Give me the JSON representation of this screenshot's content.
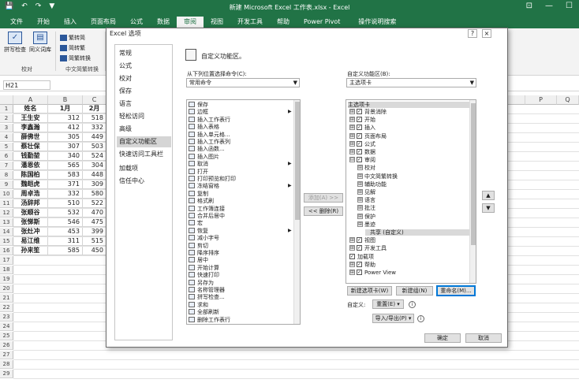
{
  "titlebar": {
    "title": "新建 Microsoft Excel 工作表.xlsx - Excel",
    "qat": [
      "💾",
      "↶",
      "↷",
      "▼"
    ],
    "winbtns": [
      "⊡",
      "—",
      "☐"
    ]
  },
  "tabs": [
    "文件",
    "开始",
    "插入",
    "页面布局",
    "公式",
    "数据",
    "审阅",
    "视图",
    "开发工具",
    "帮助",
    "Power Pivot",
    "操作说明搜索"
  ],
  "active_tab": "审阅",
  "ribbon": {
    "spell_check": "拼写检查",
    "thesaurus": "同义词库",
    "proofing_group": "校对",
    "to_traditional": "繁转简",
    "to_simplified": "简转繁",
    "convert": "简繁转换",
    "chinese_group": "中文简繁转换"
  },
  "namebox": "H21",
  "columns": [
    "A",
    "B",
    "C",
    "P",
    "Q",
    "R"
  ],
  "rows": [
    "1",
    "2",
    "3",
    "4",
    "5",
    "6",
    "7",
    "8",
    "9",
    "10",
    "11",
    "12",
    "13",
    "14",
    "15",
    "16",
    "17",
    "18",
    "19",
    "20",
    "21",
    "22",
    "23",
    "24",
    "25",
    "26",
    "27",
    "28",
    "29"
  ],
  "sheet": {
    "header": [
      "姓名",
      "1月",
      "2月"
    ],
    "records": [
      [
        "王生安",
        "312",
        "518"
      ],
      [
        "李鑫瀚",
        "412",
        "332"
      ],
      [
        "薛佛世",
        "305",
        "449"
      ],
      [
        "蔡壮保",
        "307",
        "503"
      ],
      [
        "钱勤堃",
        "340",
        "524"
      ],
      [
        "潘恩依",
        "565",
        "304"
      ],
      [
        "陈国柏",
        "583",
        "448"
      ],
      [
        "魏皑虎",
        "371",
        "309"
      ],
      [
        "周卓浩",
        "332",
        "580"
      ],
      [
        "汤辞邦",
        "510",
        "522"
      ],
      [
        "张顺谷",
        "532",
        "470"
      ],
      [
        "张悌斯",
        "546",
        "475"
      ],
      [
        "张灶冲",
        "453",
        "399"
      ],
      [
        "易江维",
        "311",
        "515"
      ],
      [
        "孙来笙",
        "585",
        "450"
      ]
    ]
  },
  "dialog": {
    "title": "Excel 选项",
    "help": "?",
    "close": "×",
    "nav": [
      "常规",
      "公式",
      "校对",
      "保存",
      "语言",
      "轻松访问",
      "高级",
      "自定义功能区",
      "快速访问工具栏",
      "加载项",
      "信任中心"
    ],
    "nav_selected": 7,
    "heading": "自定义功能区。",
    "choose_label": "从下列位置选择命令(C):",
    "choose_value": "常用命令",
    "customize_label": "自定义功能区(B):",
    "customize_value": "主选项卡",
    "commands": [
      "保存",
      "边框",
      "插入工作表行",
      "插入表格",
      "插入单元格...",
      "插入工作表列",
      "插入函数...",
      "插入图片",
      "取消",
      "打开",
      "打印预览和打印",
      "冻结窗格",
      "复制",
      "格式刷",
      "工作簿连接",
      "合并后居中",
      "宏",
      "恢复",
      "减小字号",
      "剪切",
      "降序排序",
      "居中",
      "开始计算",
      "快速打印",
      "另存为",
      "名称管理器",
      "拼写检查...",
      "求和",
      "全部刷新",
      "删除工作表行"
    ],
    "tree_header": "主选项卡",
    "tree": [
      {
        "label": "背景消除",
        "pm": "⊞",
        "cb": "✓",
        "indent": 0
      },
      {
        "label": "开始",
        "pm": "⊞",
        "cb": "✓",
        "indent": 0
      },
      {
        "label": "插入",
        "pm": "⊞",
        "cb": "✓",
        "indent": 0
      },
      {
        "label": "页面布局",
        "pm": "⊞",
        "cb": "✓",
        "indent": 0
      },
      {
        "label": "公式",
        "pm": "⊞",
        "cb": "✓",
        "indent": 0
      },
      {
        "label": "数据",
        "pm": "⊞",
        "cb": "✓",
        "indent": 0
      },
      {
        "label": "审阅",
        "pm": "⊟",
        "cb": "✓",
        "indent": 0
      },
      {
        "label": "校对",
        "pm": "⊞",
        "cb": "",
        "indent": 1
      },
      {
        "label": "中文简繁转换",
        "pm": "⊞",
        "cb": "",
        "indent": 1
      },
      {
        "label": "辅助功能",
        "pm": "⊞",
        "cb": "",
        "indent": 1
      },
      {
        "label": "见解",
        "pm": "⊞",
        "cb": "",
        "indent": 1
      },
      {
        "label": "语言",
        "pm": "⊞",
        "cb": "",
        "indent": 1
      },
      {
        "label": "批注",
        "pm": "⊞",
        "cb": "",
        "indent": 1
      },
      {
        "label": "保护",
        "pm": "⊞",
        "cb": "",
        "indent": 1
      },
      {
        "label": "墨迹",
        "pm": "⊞",
        "cb": "",
        "indent": 1
      },
      {
        "label": "共享 (自定义)",
        "pm": "",
        "cb": "",
        "indent": 2
      },
      {
        "label": "视图",
        "pm": "⊞",
        "cb": "✓",
        "indent": 0
      },
      {
        "label": "开发工具",
        "pm": "⊞",
        "cb": "✓",
        "indent": 0
      },
      {
        "label": "加载项",
        "pm": "",
        "cb": "✓",
        "indent": 0
      },
      {
        "label": "帮助",
        "pm": "⊞",
        "cb": "✓",
        "indent": 0
      },
      {
        "label": "Power View",
        "pm": "⊞",
        "cb": "✓",
        "indent": 0
      }
    ],
    "add_button": "添加(A) >>",
    "remove_button": "<< 删除(R)",
    "new_tab": "新建选项卡(W)",
    "new_group": "新建组(N)",
    "rename": "重命名(M)...",
    "customizations_label": "自定义:",
    "reset": "重置(E) ▾",
    "import_export": "导入/导出(P) ▾",
    "ok": "确定",
    "cancel": "取消",
    "up_arrow": "▲",
    "down_arrow": "▼",
    "expand_arrow": "▶",
    "info": "i"
  }
}
